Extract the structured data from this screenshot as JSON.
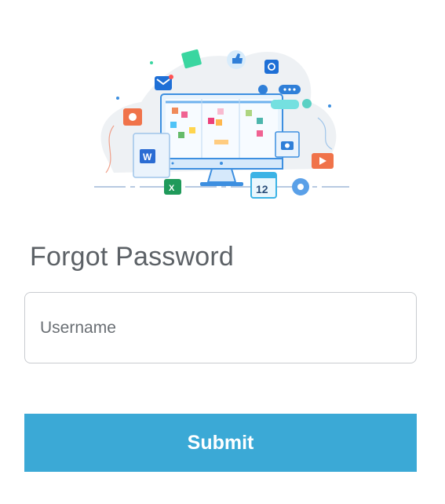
{
  "form": {
    "title": "Forgot Password",
    "username_placeholder": "Username",
    "username_value": "",
    "submit_label": "Submit"
  },
  "illustration": {
    "calendar_day": "12",
    "icons": [
      "monitor-illustration",
      "email-icon",
      "like-icon",
      "chat-bubble-icon",
      "powerpoint-icon",
      "word-icon",
      "excel-icon",
      "camera-icon",
      "video-play-icon",
      "calendar-icon",
      "gear-icon",
      "at-sign-icon"
    ]
  },
  "colors": {
    "accent": "#3ba9d6",
    "title": "#5c6166",
    "border": "#c9ccd0"
  }
}
